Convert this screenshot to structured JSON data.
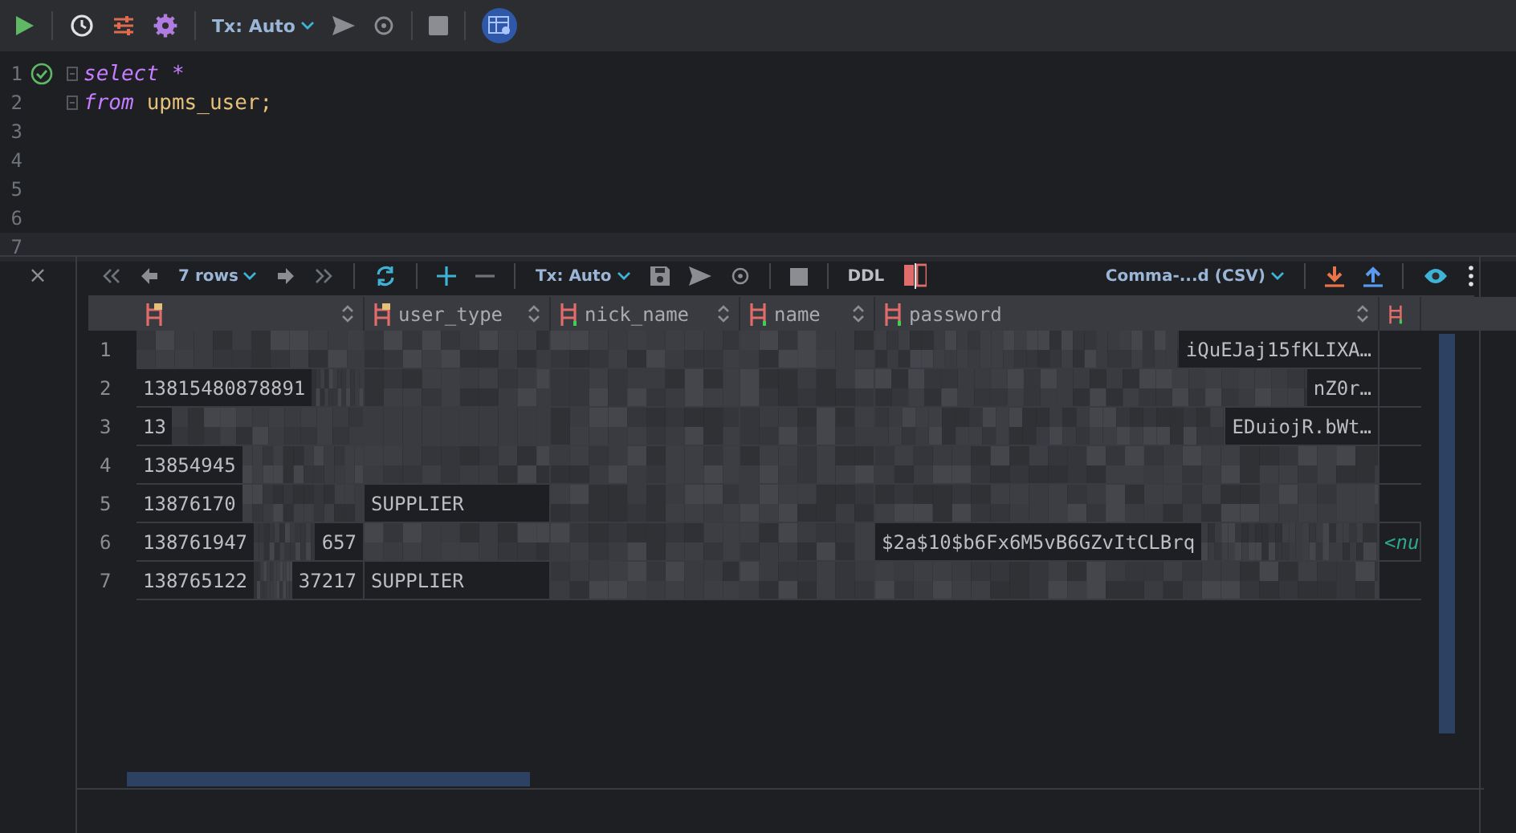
{
  "toolbar": {
    "tx_mode": "Tx: Auto"
  },
  "editor": {
    "lines": [
      {
        "number": "1",
        "success": true,
        "tokens": [
          {
            "kind": "keyword",
            "text": "select"
          },
          {
            "kind": "operator",
            "text": "*"
          }
        ],
        "current": false
      },
      {
        "number": "2",
        "tokens": [
          {
            "kind": "keyword",
            "text": "from"
          },
          {
            "kind": "identifier",
            "text": "upms_user;"
          }
        ],
        "current": false
      },
      {
        "number": "3",
        "current": false
      },
      {
        "number": "4",
        "current": false
      },
      {
        "number": "5",
        "current": false
      },
      {
        "number": "6",
        "current": false
      },
      {
        "number": "7",
        "current": true
      }
    ]
  },
  "results": {
    "close": "×",
    "toolbar": {
      "row_count": "7 rows",
      "tx_mode": "Tx: Auto",
      "ddl": "DDL",
      "export_format": "Comma-...d (CSV)"
    },
    "columns": [
      {
        "kind": "key"
      },
      {
        "kind": "key",
        "label": "user_type"
      },
      {
        "kind": "plain",
        "label": "nick_name"
      },
      {
        "kind": "plain",
        "label": "name"
      },
      {
        "kind": "plain",
        "label": "password"
      },
      {
        "kind": "cut"
      }
    ],
    "rows": [
      {
        "number": "1",
        "cells": [
          {
            "kind": "redacted"
          },
          {
            "kind": "redacted"
          },
          {
            "kind": "redacted"
          },
          {
            "kind": "redacted"
          },
          {
            "kind": "tail",
            "text": "iQuEJaj15fKLIXA…"
          },
          {
            "kind": "empty"
          }
        ]
      },
      {
        "number": "2",
        "cells": [
          {
            "kind": "head",
            "text": "13815480878891"
          },
          {
            "kind": "redacted"
          },
          {
            "kind": "redacted"
          },
          {
            "kind": "redacted"
          },
          {
            "kind": "tail",
            "text": "nZ0r…"
          },
          {
            "kind": "empty"
          }
        ]
      },
      {
        "number": "3",
        "cells": [
          {
            "kind": "head",
            "text": "13"
          },
          {
            "kind": "redacted"
          },
          {
            "kind": "redacted"
          },
          {
            "kind": "redacted"
          },
          {
            "kind": "tail",
            "text": "EDuiojR.bWt…"
          },
          {
            "kind": "empty"
          }
        ]
      },
      {
        "number": "4",
        "cells": [
          {
            "kind": "head",
            "text": "13854945"
          },
          {
            "kind": "redacted"
          },
          {
            "kind": "redacted"
          },
          {
            "kind": "redacted"
          },
          {
            "kind": "redacted"
          },
          {
            "kind": "empty"
          }
        ]
      },
      {
        "number": "5",
        "cells": [
          {
            "kind": "head",
            "text": "13876170"
          },
          {
            "kind": "text",
            "text": "SUPPLIER"
          },
          {
            "kind": "redacted"
          },
          {
            "kind": "redacted"
          },
          {
            "kind": "redacted"
          },
          {
            "kind": "empty"
          }
        ]
      },
      {
        "number": "6",
        "cells": [
          {
            "kind": "split",
            "text": "138761947",
            "tail": "657"
          },
          {
            "kind": "redacted"
          },
          {
            "kind": "redacted"
          },
          {
            "kind": "redacted"
          },
          {
            "kind": "head",
            "text": "$2a$10$b6Fx6M5vB6GZvItCLBrq"
          },
          {
            "kind": "null",
            "text": "<nu"
          }
        ]
      },
      {
        "number": "7",
        "cells": [
          {
            "kind": "split",
            "text": "138765122",
            "tail": "37217"
          },
          {
            "kind": "text",
            "text": "SUPPLIER"
          },
          {
            "kind": "redacted"
          },
          {
            "kind": "redacted"
          },
          {
            "kind": "redacted"
          },
          {
            "kind": "empty"
          }
        ]
      }
    ]
  }
}
